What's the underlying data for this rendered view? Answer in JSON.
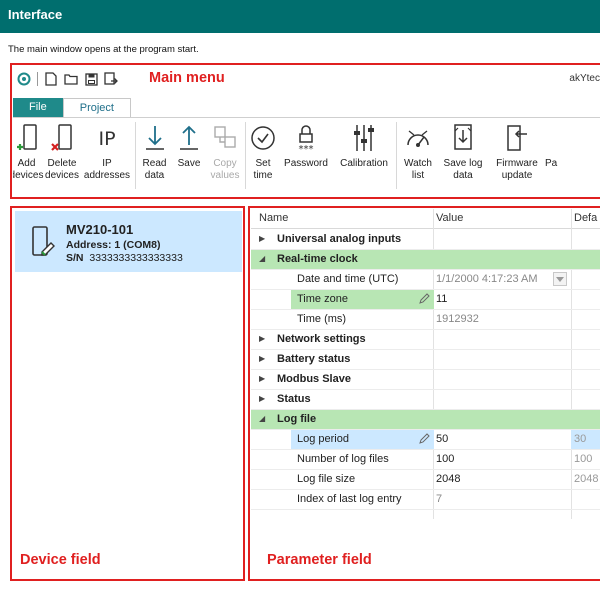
{
  "doc": {
    "title": "Interface",
    "caption": "The main window opens at the program start."
  },
  "callouts": {
    "main_menu": "Main menu",
    "device_field": "Device field",
    "parameter_field": "Parameter field"
  },
  "app": {
    "brand": "akYtec",
    "tabs": [
      {
        "label": "File"
      },
      {
        "label": "Project"
      }
    ],
    "ribbon": [
      {
        "l1": "Add",
        "l2": "devices",
        "icon": "add-device-icon"
      },
      {
        "l1": "Delete",
        "l2": "devices",
        "icon": "delete-device-icon"
      },
      {
        "l1": "IP",
        "l2": "addresses",
        "icon": "ip-icon"
      },
      {
        "l1": "Read",
        "l2": "data",
        "icon": "read-data-icon"
      },
      {
        "l1": "Save",
        "l2": "",
        "icon": "save-arrow-icon"
      },
      {
        "l1": "Copy",
        "l2": "values",
        "icon": "copy-values-icon"
      },
      {
        "l1": "Set",
        "l2": "time",
        "icon": "clock-icon"
      },
      {
        "l1": "Password",
        "l2": "",
        "icon": "lock-icon"
      },
      {
        "l1": "Calibration",
        "l2": "",
        "icon": "calibration-icon"
      },
      {
        "l1": "Watch",
        "l2": "list",
        "icon": "watch-list-icon"
      },
      {
        "l1": "Save log",
        "l2": "data",
        "icon": "save-log-icon"
      },
      {
        "l1": "Firmware",
        "l2": "update",
        "icon": "firmware-icon"
      },
      {
        "l1": "Pa",
        "l2": "",
        "icon": "partial-icon"
      }
    ]
  },
  "device": {
    "name": "MV210-101",
    "address": "Address: 1 (COM8)",
    "sn_label": "S/N",
    "sn_value": "3333333333333333"
  },
  "grid": {
    "headers": {
      "name": "Name",
      "value": "Value",
      "default": "Defa"
    },
    "rows": [
      {
        "name": "Universal analog inputs",
        "value": "",
        "default": ""
      },
      {
        "name": "Real-time clock",
        "value": "",
        "default": ""
      },
      {
        "name": "Date and time (UTC)",
        "value": "1/1/2000 4:17:23 AM",
        "default": ""
      },
      {
        "name": "Time zone",
        "value": "11",
        "default": ""
      },
      {
        "name": "Time (ms)",
        "value": "1912932",
        "default": ""
      },
      {
        "name": "Network settings",
        "value": "",
        "default": ""
      },
      {
        "name": "Battery status",
        "value": "",
        "default": ""
      },
      {
        "name": "Modbus Slave",
        "value": "",
        "default": ""
      },
      {
        "name": "Status",
        "value": "",
        "default": ""
      },
      {
        "name": "Log file",
        "value": "",
        "default": ""
      },
      {
        "name": "Log period",
        "value": "50",
        "default": "30"
      },
      {
        "name": "Number of log files",
        "value": "100",
        "default": "100"
      },
      {
        "name": "Log file size",
        "value": "2048",
        "default": "2048"
      },
      {
        "name": "Index of last log entry",
        "value": "7",
        "default": ""
      }
    ]
  },
  "colors": {
    "header_bg": "#006e6e",
    "frame_red": "#e02020",
    "tab_teal": "#1f8a8a",
    "group_green": "#b8e6b4",
    "select_blue": "#cce8ff"
  }
}
